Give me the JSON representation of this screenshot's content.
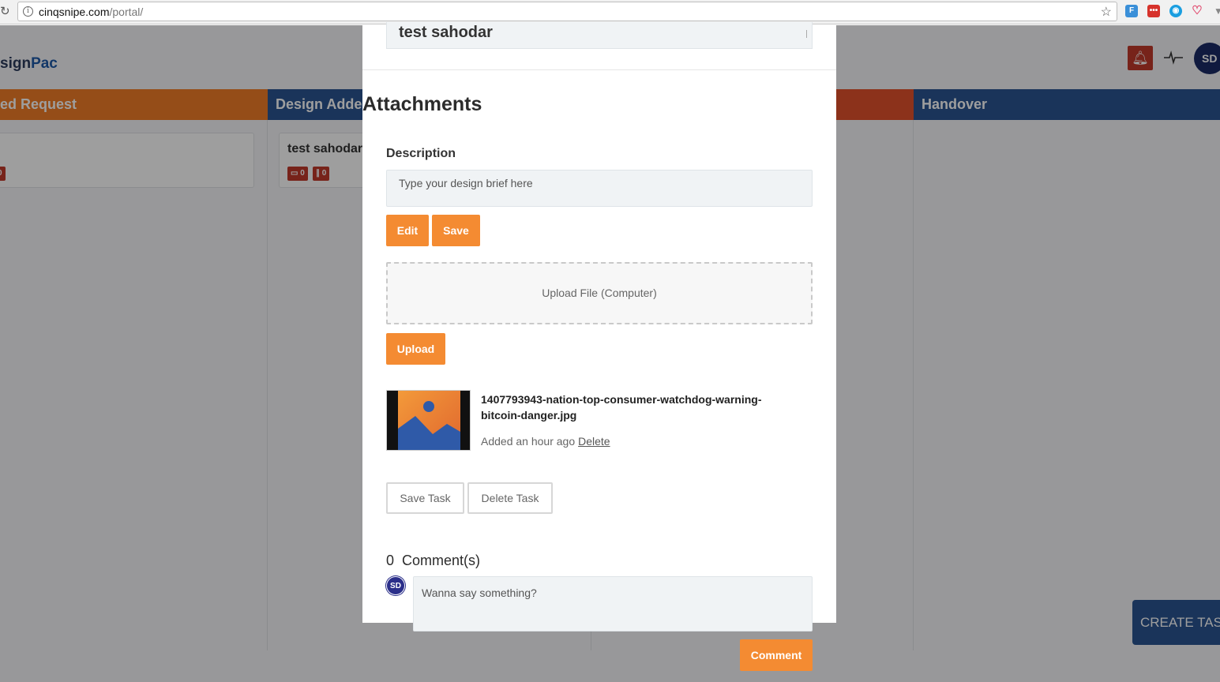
{
  "browser": {
    "url_host": "cinqsnipe.com",
    "url_path": "/portal/"
  },
  "app": {
    "brand_prefix": "sign",
    "brand_suffix": "Pac",
    "avatar_initials": "SD",
    "columns": [
      {
        "title": "ed Request",
        "color": "#f07d27"
      },
      {
        "title": "Design Added",
        "color": "#2a5591"
      },
      {
        "title": "",
        "color": "#e2512c"
      },
      {
        "title": "Handover",
        "color": "#2a5591"
      }
    ],
    "cards": [
      {
        "title": "",
        "comment_count": "0",
        "attachment_count": "0"
      },
      {
        "title": "test sahodar",
        "comment_count": "0",
        "attachment_count": "0"
      }
    ],
    "create_task_label": "CREATE TASK"
  },
  "modal": {
    "task_title": "test sahodar",
    "section_title": "Attachments",
    "description_label": "Description",
    "description_placeholder": "Type your design brief here",
    "edit_label": "Edit",
    "save_label": "Save",
    "dropzone_label": "Upload File (Computer)",
    "upload_label": "Upload",
    "attachment": {
      "file_name": "1407793943-nation-top-consumer-watchdog-warning-bitcoin-danger.jpg",
      "added_text": "Added an hour ago",
      "delete_label": "Delete"
    },
    "save_task_label": "Save Task",
    "delete_task_label": "Delete Task",
    "comments_count": "0",
    "comments_label": "Comment(s)",
    "comment_avatar": "SD",
    "comment_placeholder": "Wanna say something?",
    "comment_button_label": "Comment"
  }
}
